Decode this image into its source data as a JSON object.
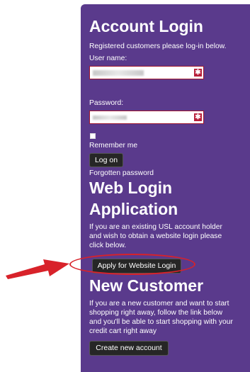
{
  "login": {
    "title": "Account Login",
    "subtitle": "Registered customers please log-in below.",
    "username_label": "User name:",
    "password_label": "Password:",
    "remember_label": "Remember me",
    "logon_button": "Log on",
    "forgot_link": "Forgotten password"
  },
  "web_login": {
    "title_line1": "Web Login",
    "title_line2": "Application",
    "desc": [
      "If you are an existing USL account holder",
      "and wish to obtain a website login please",
      "click below."
    ],
    "apply_button": "Apply for Website Login"
  },
  "new_customer": {
    "title": "New Customer",
    "desc": [
      "If you are a new customer and want to start",
      "shopping right away, follow the link below",
      "and you'll be able to start shopping with your",
      "credit cart right away"
    ],
    "create_button": "Create new account"
  },
  "colors": {
    "panel_bg": "#5a3a8c",
    "button_bg": "#262626",
    "required_marker": "#b8203a",
    "annotation_red": "#d8222a"
  },
  "icons": {
    "required_marker": "asterisk-icon",
    "annotation": "red-arrow-icon"
  },
  "required_symbol": "✱"
}
